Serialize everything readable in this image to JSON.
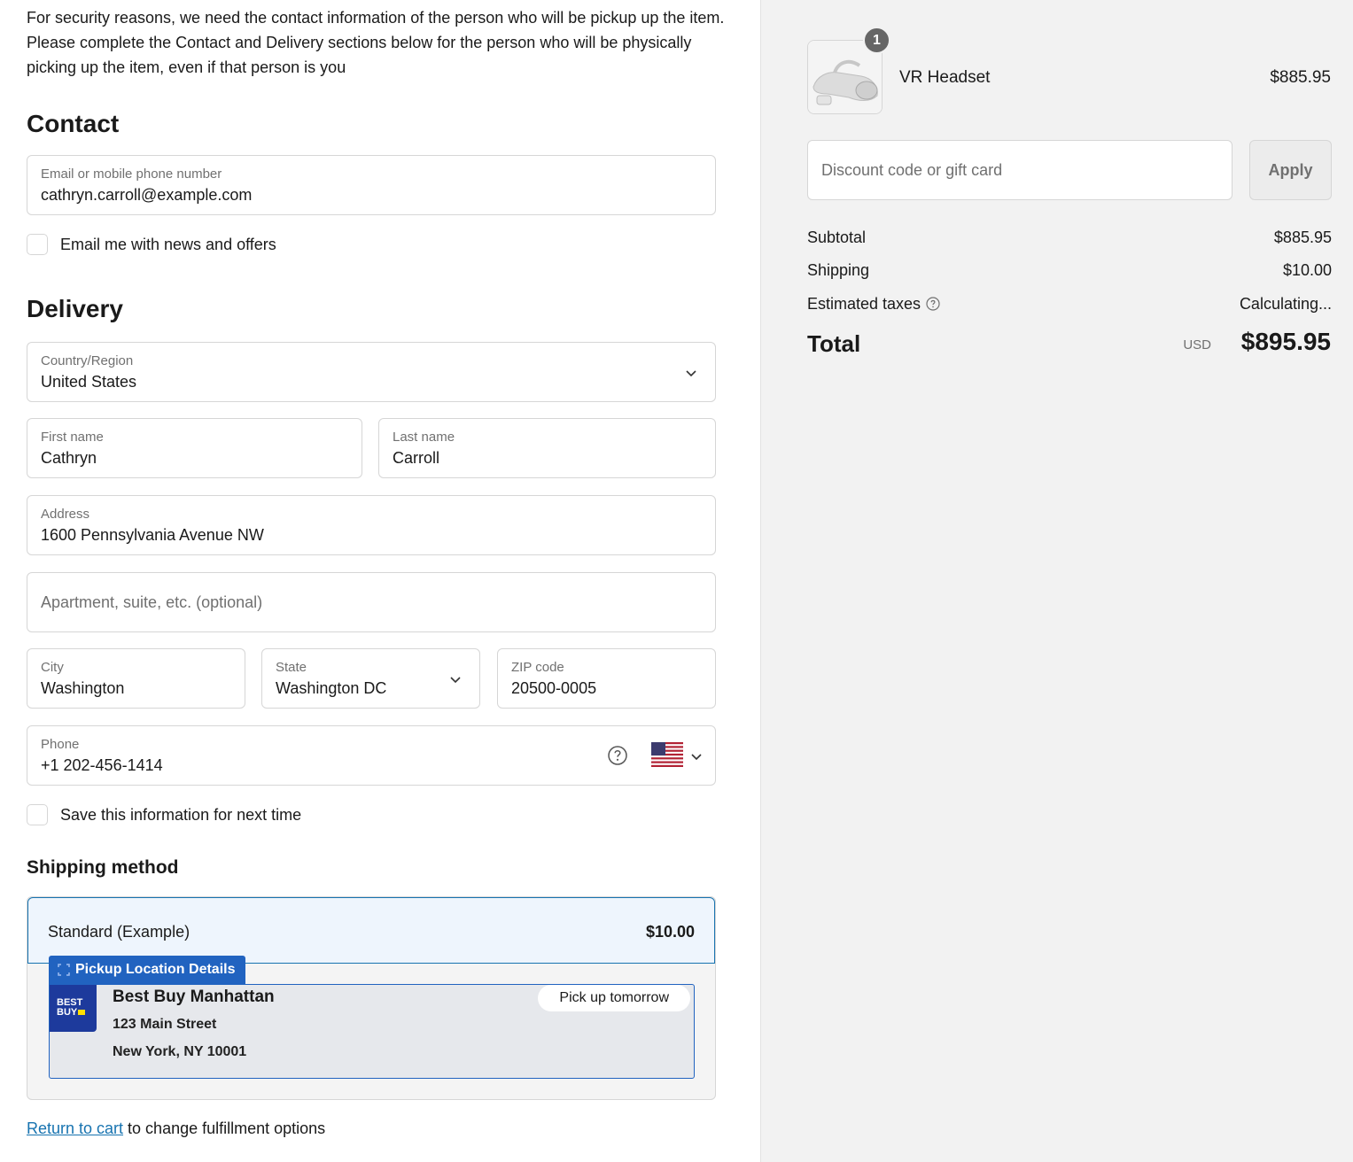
{
  "notice": "For security reasons, we need the contact information of the person who will be pickup up the item. Please complete the Contact and Delivery sections below for the person who will be physically picking up the item, even if that person is you",
  "contact": {
    "heading": "Contact",
    "email_label": "Email or mobile phone number",
    "email_value": "cathryn.carroll@example.com",
    "newsletter_label": "Email me with news and offers"
  },
  "delivery": {
    "heading": "Delivery",
    "country_label": "Country/Region",
    "country_value": "United States",
    "first_name_label": "First name",
    "first_name_value": "Cathryn",
    "last_name_label": "Last name",
    "last_name_value": "Carroll",
    "address_label": "Address",
    "address_value": "1600 Pennsylvania Avenue NW",
    "apartment_placeholder": "Apartment, suite, etc. (optional)",
    "city_label": "City",
    "city_value": "Washington",
    "state_label": "State",
    "state_value": "Washington DC",
    "zip_label": "ZIP code",
    "zip_value": "20500-0005",
    "phone_label": "Phone",
    "phone_value": "+1 202-456-1414",
    "save_info_label": "Save this information for next time"
  },
  "shipping": {
    "heading": "Shipping method",
    "option_name": "Standard (Example)",
    "option_price": "$10.00",
    "pickup_tag": "Pickup Location Details",
    "store_logo_line1": "BEST",
    "store_logo_line2": "BUY",
    "store_name": "Best Buy Manhattan",
    "store_street": "123 Main Street",
    "store_city": "New York, NY 10001",
    "pickup_time": "Pick up tomorrow"
  },
  "footer": {
    "return_link": "Return to cart",
    "return_rest": " to change fulfillment options"
  },
  "summary": {
    "item_qty": "1",
    "item_name": "VR Headset",
    "item_price": "$885.95",
    "discount_placeholder": "Discount code or gift card",
    "apply_label": "Apply",
    "subtotal_label": "Subtotal",
    "subtotal_value": "$885.95",
    "shipping_label": "Shipping",
    "shipping_value": "$10.00",
    "taxes_label": "Estimated taxes",
    "taxes_value": "Calculating...",
    "total_label": "Total",
    "total_currency": "USD",
    "total_value": "$895.95"
  },
  "colors": {
    "link": "#1773b0",
    "pickup_blue": "#2163c0",
    "selected_bg": "#eef5fd"
  },
  "icons": {
    "dropdown": "chevron-down-icon",
    "help": "question-circle-icon",
    "flag": "us-flag-icon"
  }
}
